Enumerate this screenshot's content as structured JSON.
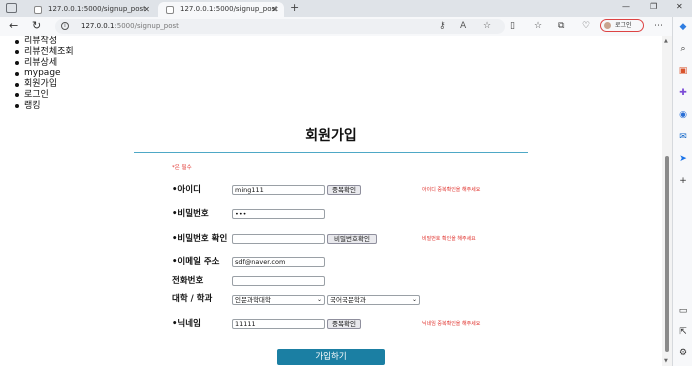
{
  "browser": {
    "tabs": [
      {
        "title": "127.0.0.1:5000/signup_post",
        "close": "✕"
      },
      {
        "title": "127.0.0.1:5000/signup_post",
        "close": "✕"
      }
    ],
    "new_tab": "+",
    "window_controls": [
      "—",
      "❐",
      "✕"
    ],
    "url_host": "127.0.0.1",
    "url_path": ":5000/signup_post",
    "login_label": "로그인",
    "more": "⋯"
  },
  "nav": {
    "items": [
      "리뷰작성",
      "리뷰전체조회",
      "리뷰상세",
      "mypage",
      "회원가입",
      "로그인",
      "랭킹"
    ]
  },
  "page": {
    "title": "회원가입",
    "required_note": "*은 필수"
  },
  "form": {
    "id_label": "•아이디",
    "id_value": "ming111",
    "id_check_button": "중복확인",
    "id_hint": "아이디 중복확인을 해주세요",
    "pw_label": "•비밀번호",
    "pw_value": "•••",
    "pw_confirm_label": "•비밀번호 확인",
    "pw_confirm_value": "",
    "pw_check_button": "비밀번호확인",
    "pw_hint": "비밀번호 확인을 해주세요",
    "email_label": "•이메일 주소",
    "email_value": "sdf@naver.com",
    "phone_label": "전화번호",
    "phone_value": "",
    "school_label": "대학 / 학과",
    "college_value": "인문과학대학",
    "major_value": "국어국문학과",
    "nickname_label": "•닉네임",
    "nickname_value": "11111",
    "nick_check_button": "중복확인",
    "nick_hint": "닉네임 중복확인을 해주세요",
    "submit_label": "가입하기"
  },
  "colors": {
    "accent": "#1b7fa3",
    "divider": "#4ea8c6",
    "warning": "#e0302b"
  }
}
